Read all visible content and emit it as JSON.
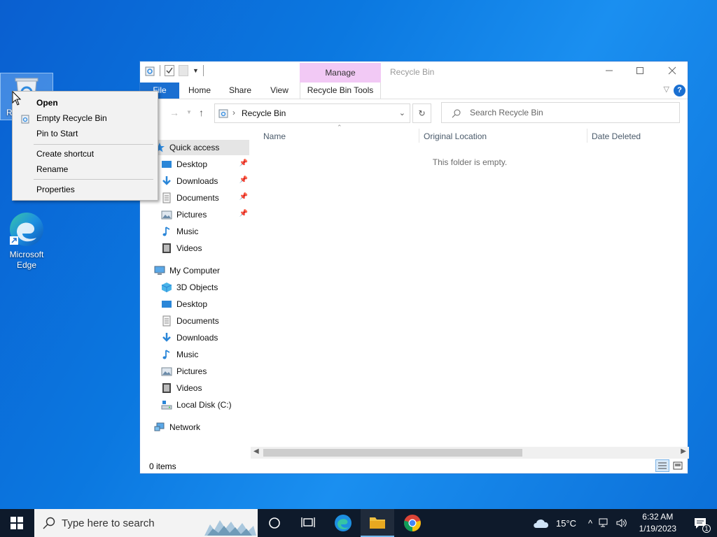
{
  "desktop": {
    "icons": [
      {
        "label": "Recycle Bin",
        "visible_label": "R"
      },
      {
        "label": "Microsoft Edge"
      }
    ]
  },
  "context_menu": {
    "items": [
      {
        "label": "Open"
      },
      {
        "label": "Empty Recycle Bin"
      },
      {
        "label": "Pin to Start"
      },
      {
        "label": "Create shortcut"
      },
      {
        "label": "Rename"
      },
      {
        "label": "Properties"
      }
    ]
  },
  "explorer": {
    "title": "Recycle Bin",
    "ribbon": {
      "context_group": "Manage",
      "tabs": [
        "File",
        "Home",
        "Share",
        "View",
        "Recycle Bin Tools"
      ],
      "help": "?"
    },
    "address": {
      "crumb": "Recycle Bin"
    },
    "search": {
      "placeholder": "Search Recycle Bin"
    },
    "nav": {
      "quick_access": "Quick access",
      "quick_items": [
        "Desktop",
        "Downloads",
        "Documents",
        "Pictures",
        "Music",
        "Videos"
      ],
      "computer": "My Computer",
      "computer_items": [
        "3D Objects",
        "Desktop",
        "Documents",
        "Downloads",
        "Music",
        "Pictures",
        "Videos",
        "Local Disk (C:)"
      ],
      "network": "Network"
    },
    "columns": [
      "Name",
      "Original Location",
      "Date Deleted"
    ],
    "empty_message": "This folder is empty.",
    "status": "0 items"
  },
  "taskbar": {
    "search_placeholder": "Type here to search",
    "weather": "15°C",
    "time": "6:32 AM",
    "date": "1/19/2023",
    "notification_count": "1"
  },
  "colors": {
    "accent": "#1a6fd1",
    "manage_band": "#f2c9f5",
    "taskbar": "#0e1a2b"
  }
}
